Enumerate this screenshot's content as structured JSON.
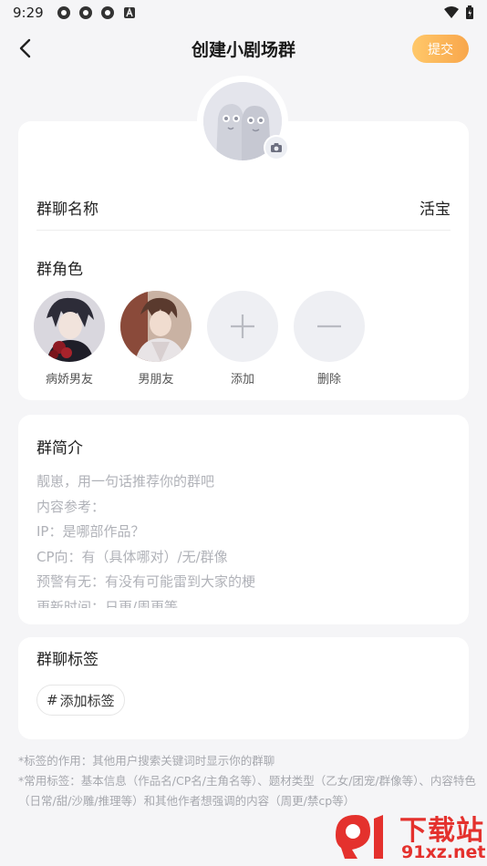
{
  "status_bar": {
    "time": "9:29"
  },
  "nav": {
    "title": "创建小剧场群",
    "submit_label": "提交"
  },
  "group": {
    "name_label": "群聊名称",
    "name_value": "活宝"
  },
  "roles": {
    "label": "群角色",
    "items": [
      {
        "name": "病娇男友"
      },
      {
        "name": "男朋友"
      }
    ],
    "add_label": "添加",
    "delete_label": "删除"
  },
  "intro": {
    "label": "群简介",
    "placeholder_lines": [
      "靓崽，用一句话推荐你的群吧",
      "内容参考：",
      "IP：是哪部作品？",
      "CP向：有（具体哪对）/无/群像",
      "预警有无：有没有可能雷到大家的梗",
      "更新时间：日更/周更等"
    ]
  },
  "tags": {
    "label": "群聊标签",
    "add_label": "添加标签",
    "hash": "#"
  },
  "notes": {
    "line1": "*标签的作用：其他用户搜索关键词时显示你的群聊",
    "line2": "*常用标签：基本信息（作品名/CP名/主角名等）、题材类型（乙女/团宠/群像等）、内容特色（日常/甜/沙雕/推理等）和其他作者想强调的内容（周更/禁cp等）"
  },
  "watermark": {
    "cn": "下载站",
    "url": "91xz.net"
  },
  "colors": {
    "accent": "#f8a64b",
    "placeholder": "#b0b2b8",
    "watermark": "#e4312d"
  }
}
